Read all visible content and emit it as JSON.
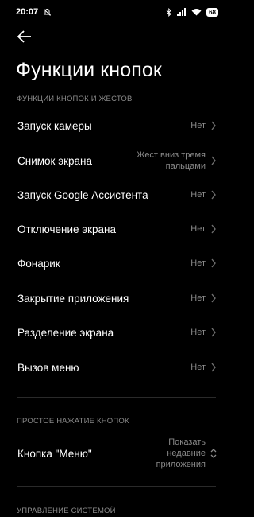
{
  "status_bar": {
    "time": "20:07",
    "battery": "68"
  },
  "page": {
    "title": "Функции кнопок"
  },
  "sections": {
    "gestures_header": "ФУНКЦИИ КНОПОК И ЖЕСТОВ",
    "simple_press_header": "ПРОСТОЕ НАЖАТИЕ КНОПОК",
    "system_header": "УПРАВЛЕНИЕ СИСТЕМОЙ"
  },
  "rows": [
    {
      "label": "Запуск камеры",
      "value": "Нет"
    },
    {
      "label": "Снимок экрана",
      "value": "Жест вниз тремя пальцами"
    },
    {
      "label": "Запуск Google Ассистента",
      "value": "Нет"
    },
    {
      "label": "Отключение экрана",
      "value": "Нет"
    },
    {
      "label": "Фонарик",
      "value": "Нет"
    },
    {
      "label": "Закрытие приложения",
      "value": "Нет"
    },
    {
      "label": "Разделение экрана",
      "value": "Нет"
    },
    {
      "label": "Вызов меню",
      "value": "Нет"
    }
  ],
  "menu_button": {
    "label": "Кнопка \"Меню\"",
    "value": "Показать недавние приложения"
  },
  "icons": {
    "back": "arrow-left-icon",
    "chevron": "chevron-right-icon",
    "updown": "chevron-up-down-icon"
  },
  "colors": {
    "background": "#000000",
    "secondary_text": "#8a8a8a"
  }
}
